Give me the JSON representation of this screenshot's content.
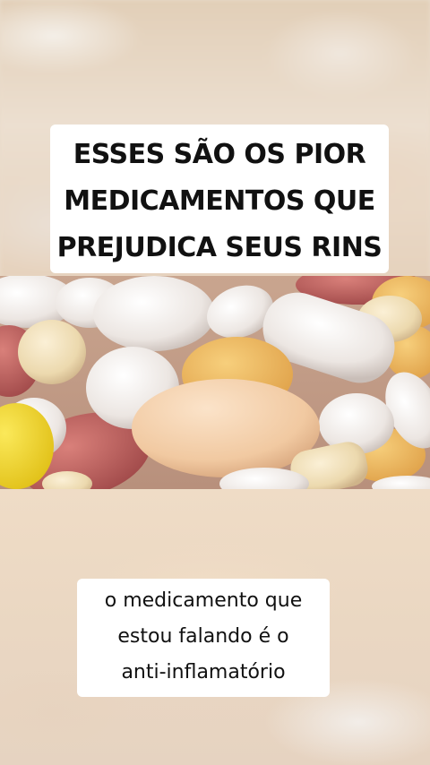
{
  "caption_top": {
    "lines": [
      "ESSES SÃO OS PIOR",
      "MEDICAMENTOS QUE",
      "PREJUDICA SEUS RINS"
    ]
  },
  "caption_bottom": {
    "lines": [
      "o medicamento que",
      "estou falando é o",
      "anti-inflamatório"
    ]
  },
  "image_subject": "pills-photo",
  "colors": {
    "caption_background": "#ffffff",
    "caption_text": "#111111"
  }
}
